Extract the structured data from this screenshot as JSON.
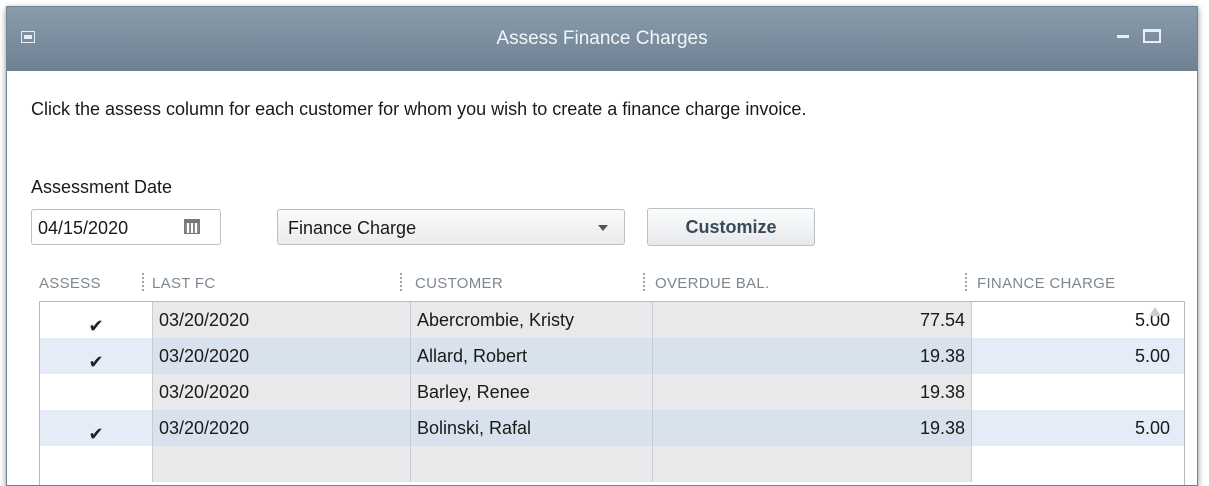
{
  "window": {
    "title": "Assess Finance Charges",
    "instruction": "Click the assess column for each customer for whom you wish to create a finance charge invoice."
  },
  "assessment": {
    "date_label": "Assessment Date",
    "date_value": "04/15/2020",
    "template_value": "Finance Charge",
    "customize_label": "Customize"
  },
  "table": {
    "headers": [
      "ASSESS",
      "LAST FC",
      "CUSTOMER",
      "OVERDUE BAL.",
      "FINANCE CHARGE"
    ],
    "rows": [
      {
        "assess": "✔",
        "last_fc": "03/20/2020",
        "customer": "Abercrombie, Kristy",
        "overdue_bal": "77.54",
        "finance_charge": "5.00"
      },
      {
        "assess": "✔",
        "last_fc": "03/20/2020",
        "customer": "Allard, Robert",
        "overdue_bal": "19.38",
        "finance_charge": "5.00"
      },
      {
        "assess": "",
        "last_fc": "03/20/2020",
        "customer": "Barley, Renee",
        "overdue_bal": "19.38",
        "finance_charge": ""
      },
      {
        "assess": "✔",
        "last_fc": "03/20/2020",
        "customer": "Bolinski, Rafal",
        "overdue_bal": "19.38",
        "finance_charge": "5.00"
      }
    ]
  },
  "icons": {
    "system_menu": "system-menu-icon",
    "minimize": "minimize-icon",
    "maximize": "maximize-icon",
    "calendar": "calendar-icon",
    "dropdown": "chevron-down-icon",
    "check": "checkmark-icon",
    "scroll_up": "scroll-up-icon"
  },
  "colors": {
    "titlebar": "#7b8d9e",
    "row_alt": "#e4edf7",
    "header_text": "#7d8790"
  }
}
